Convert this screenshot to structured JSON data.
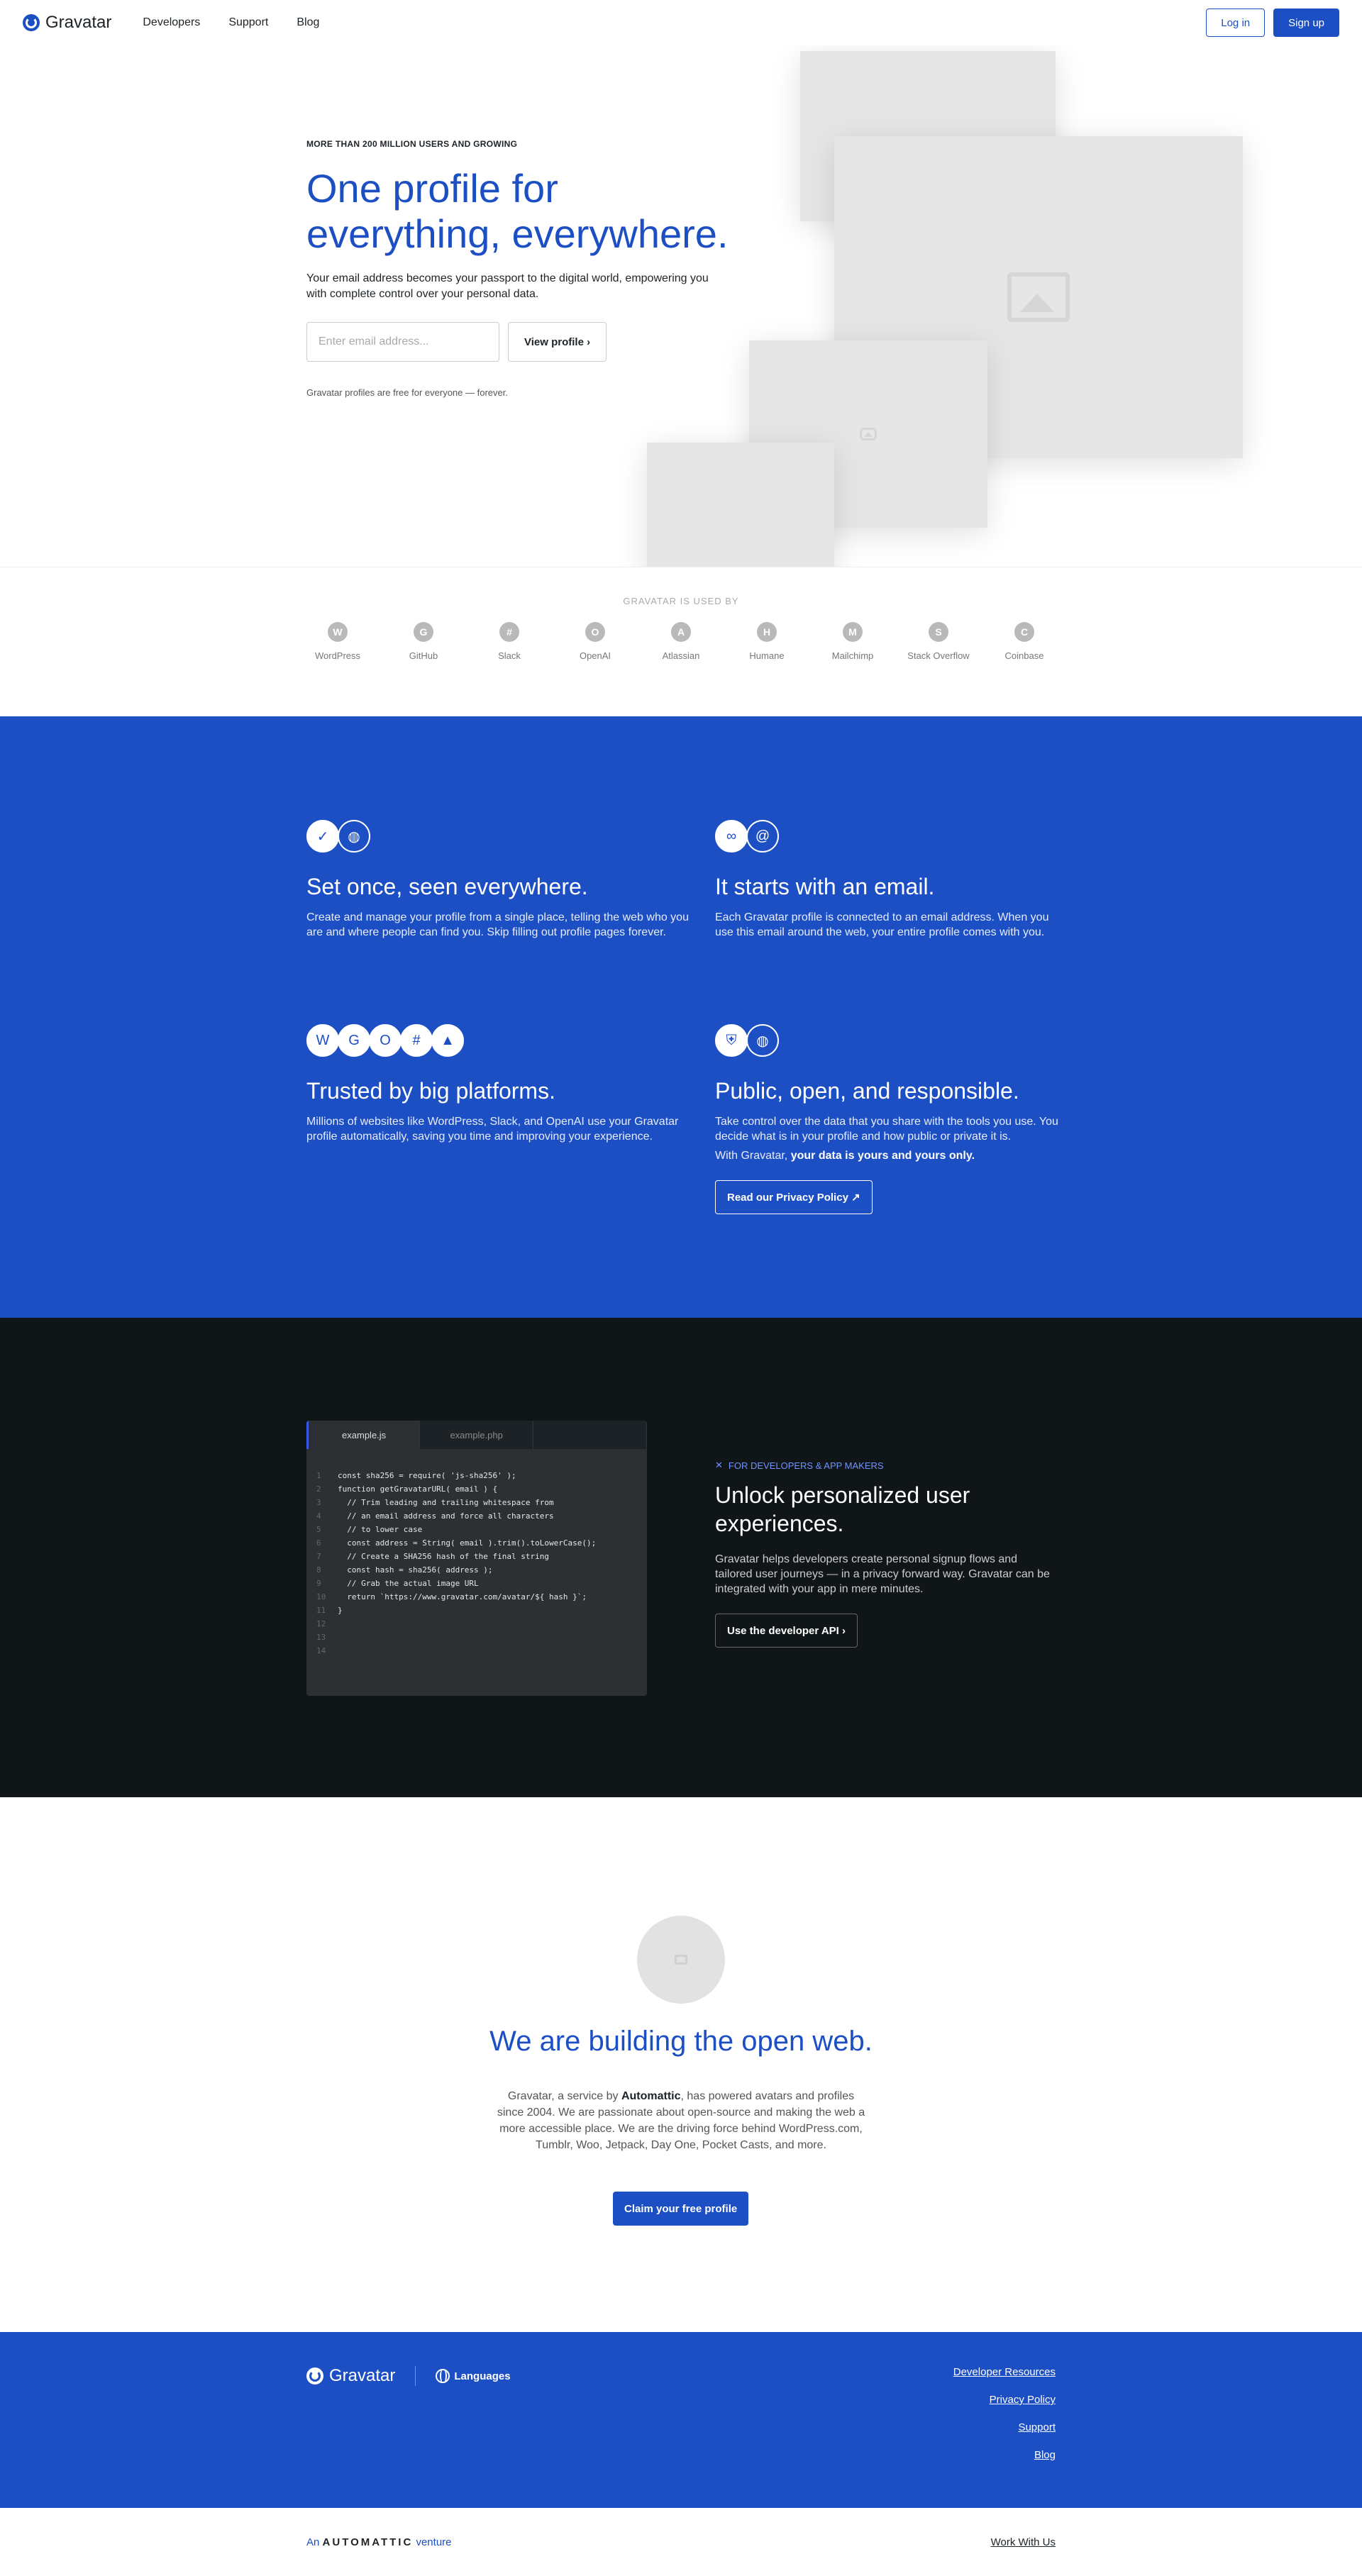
{
  "header": {
    "logo_text": "Gravatar",
    "nav": [
      "Developers",
      "Support",
      "Blog"
    ],
    "login": "Log in",
    "signup": "Sign up"
  },
  "hero": {
    "eyebrow": "More than 200 million users and growing",
    "title_line1": "One profile for",
    "title_line2": "everything, everywhere.",
    "subtitle": "Your email address becomes your passport to the digital world, empowering you with complete control over your personal data.",
    "email_placeholder": "Enter email address...",
    "view_button": "View profile ›",
    "note": "Gravatar profiles are free for everyone — forever."
  },
  "used_by": {
    "label": "Gravatar is used by",
    "logos": [
      {
        "name": "WordPress",
        "icon": "W"
      },
      {
        "name": "GitHub",
        "icon": "G"
      },
      {
        "name": "Slack",
        "icon": "#"
      },
      {
        "name": "OpenAI",
        "icon": "O"
      },
      {
        "name": "Atlassian",
        "icon": "A"
      },
      {
        "name": "Humane",
        "icon": "H"
      },
      {
        "name": "Mailchimp",
        "icon": "M"
      },
      {
        "name": "Stack Overflow",
        "icon": "S"
      },
      {
        "name": "Coinbase",
        "icon": "C"
      }
    ]
  },
  "features": {
    "f1": {
      "title": "Set once, seen everywhere.",
      "desc": "Create and manage your profile from a single place, telling the web who you are and where people can find you. Skip filling out profile pages forever."
    },
    "f2": {
      "title": "It starts with an email.",
      "desc": "Each Gravatar profile is connected to an email address. When you use this email around the web, your entire profile comes with you."
    },
    "f3": {
      "title": "Trusted by big platforms.",
      "desc": "Millions of websites like WordPress, Slack, and OpenAI use your Gravatar profile automatically, saving you time and improving your experience."
    },
    "f4": {
      "title": "Public, open, and responsible.",
      "desc": "Take control over the data that you share with the tools you use. You decide what is in your profile and how public or private it is.",
      "desc2_prefix": "With Gravatar, ",
      "desc2_bold": "your data is yours and yours only.",
      "button": "Read our Privacy Policy ↗"
    }
  },
  "developers": {
    "tabs": [
      "example.js",
      "example.php",
      ""
    ],
    "code": [
      "const sha256 = require( 'js-sha256' );",
      "function getGravatarURL( email ) {",
      "  // Trim leading and trailing whitespace from",
      "  // an email address and force all characters",
      "  // to lower case",
      "  const address = String( email ).trim().toLowerCase();",
      "  // Create a SHA256 hash of the final string",
      "  const hash = sha256( address );",
      "  // Grab the actual image URL",
      "  return `https://www.gravatar.com/avatar/${ hash }`;",
      "}",
      "",
      "",
      ""
    ],
    "eyebrow": "For developers & app makers",
    "title": "Unlock personalized user experiences.",
    "desc": "Gravatar helps developers create personal signup flows and tailored user journeys — in a privacy forward way. Gravatar can be integrated with your app in mere minutes.",
    "button": "Use the developer API ›"
  },
  "open_web": {
    "title": "We are building the open web.",
    "desc_prefix": "Gravatar, a service by ",
    "desc_bold": "Automattic",
    "desc_suffix": ", has powered avatars and profiles since 2004. We are passionate about open-source and making the web a more accessible place. We are the driving force behind WordPress.com, Tumblr, Woo, Jetpack, Day One, Pocket Casts, and more.",
    "button": "Claim your free profile"
  },
  "footer": {
    "logo_text": "Gravatar",
    "languages": "Languages",
    "links": [
      "Developer Resources",
      "Privacy Policy",
      "Support",
      "Blog"
    ],
    "venture_prefix": "An",
    "venture_brand": "AUTOMATTIC",
    "venture_suffix": "venture",
    "work_with_us": "Work With Us"
  },
  "colors": {
    "brand_blue": "#1d4fc4",
    "dark": "#101517"
  }
}
